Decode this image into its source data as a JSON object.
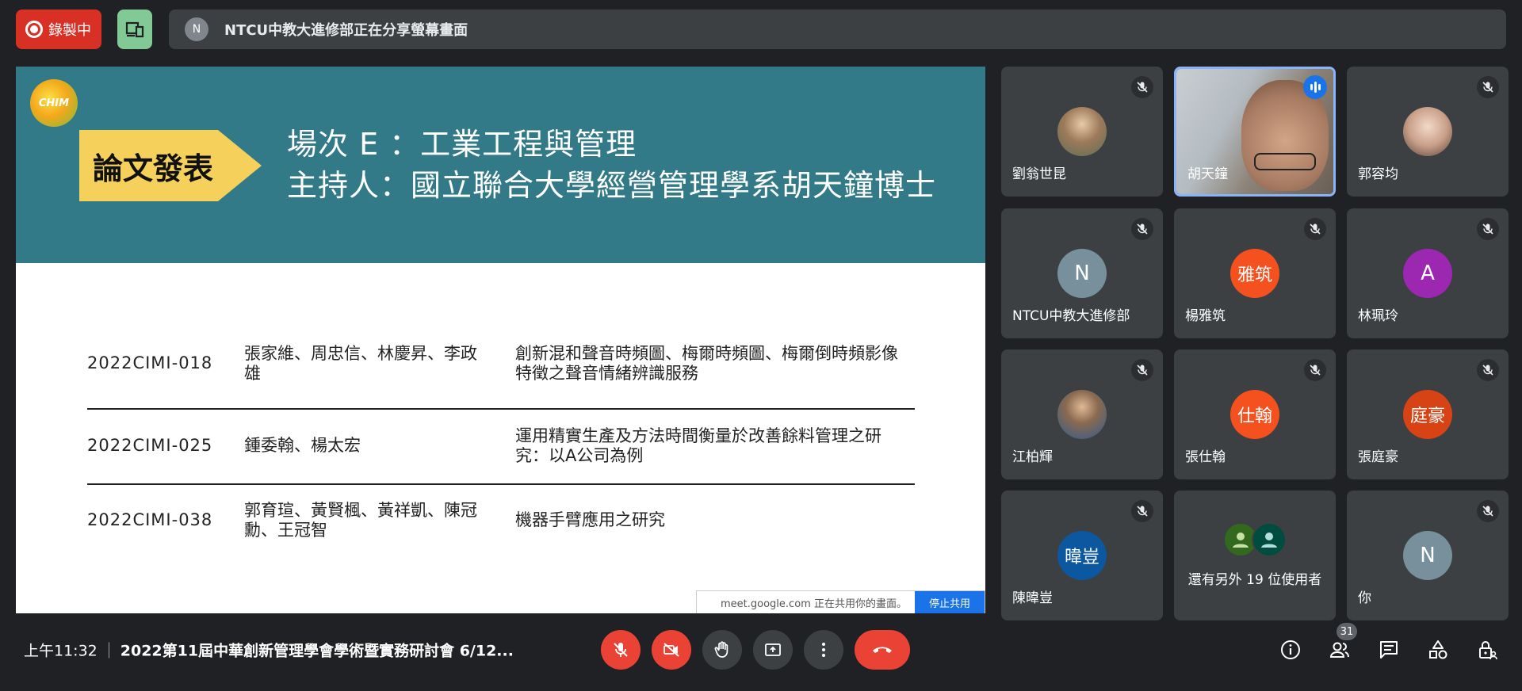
{
  "topbar": {
    "record_label": "錄製中",
    "share_avatar": "N",
    "share_banner": "NTCU中教大進修部正在分享螢幕畫面"
  },
  "slide": {
    "badge": "論文發表",
    "title_line1": "場次 E ：工業工程與管理",
    "title_line2": "主持人：國立聯合大學經營管理學系胡天鐘博士",
    "rows": [
      {
        "id": "2022CIMI-018",
        "authors": "張家維、周忠信、林慶昇、李政雄",
        "title": "創新混和聲音時頻圖、梅爾時頻圖、梅爾倒時頻影像特徵之聲音情緒辨識服務"
      },
      {
        "id": "2022CIMI-025",
        "authors": "鍾委翰、楊太宏",
        "title": "運用精實生產及方法時間衡量於改善餘料管理之研究：以A公司為例"
      },
      {
        "id": "2022CIMI-038",
        "authors": "郭育瑄、黃賢楓、黃祥凱、陳冠勳、王冠智",
        "title": "機器手臂應用之研究"
      }
    ],
    "share_notice": "meet.google.com 正在共用你的畫面。",
    "stop_share": "停止共用"
  },
  "participants": [
    {
      "name": "劉翁世昆",
      "avatar": "",
      "kind": "photo"
    },
    {
      "name": "胡天鐘",
      "avatar": "",
      "kind": "video"
    },
    {
      "name": "郭容均",
      "avatar": "",
      "kind": "photo"
    },
    {
      "name": "NTCU中教大進修部",
      "avatar": "N",
      "kind": "letter",
      "color": "#78909c"
    },
    {
      "name": "楊雅筑",
      "avatar": "雅筑",
      "kind": "letter",
      "color": "#f4511e"
    },
    {
      "name": "林珮玲",
      "avatar": "A",
      "kind": "letter",
      "color": "#9c27b0"
    },
    {
      "name": "江柏輝",
      "avatar": "",
      "kind": "photo"
    },
    {
      "name": "張仕翰",
      "avatar": "仕翰",
      "kind": "letter",
      "color": "#f4511e"
    },
    {
      "name": "張庭豪",
      "avatar": "庭豪",
      "kind": "letter",
      "color": "#d84315"
    },
    {
      "name": "陳暐豈",
      "avatar": "暐豈",
      "kind": "letter",
      "color": "#0b57a0"
    },
    {
      "name": "還有另外 19 位使用者",
      "avatar": "",
      "kind": "others"
    },
    {
      "name": "你",
      "avatar": "N",
      "kind": "letter",
      "color": "#78909c"
    }
  ],
  "bottombar": {
    "time": "上午11:32",
    "meeting_name": "2022第11屆中華創新管理學會學術暨實務研討會 6/12...",
    "participant_count": "31"
  },
  "colors": {
    "record": "#d93025",
    "accent": "#1a73e8",
    "danger": "#ea4335",
    "slide_header": "#327a87",
    "badge": "#f5d05b"
  }
}
